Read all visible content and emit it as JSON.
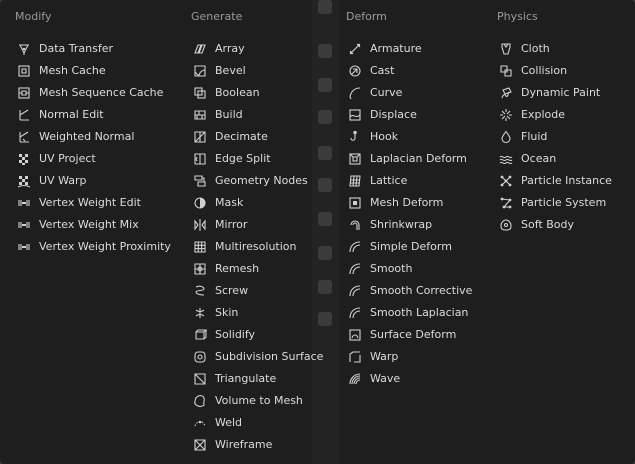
{
  "columns": [
    {
      "header": "Modify",
      "items": [
        {
          "label": "Data Transfer",
          "icon": "data-transfer"
        },
        {
          "label": "Mesh Cache",
          "icon": "mesh-cache"
        },
        {
          "label": "Mesh Sequence Cache",
          "icon": "mesh-sequence-cache"
        },
        {
          "label": "Normal Edit",
          "icon": "normal-edit"
        },
        {
          "label": "Weighted Normal",
          "icon": "weighted-normal"
        },
        {
          "label": "UV Project",
          "icon": "uv-project"
        },
        {
          "label": "UV Warp",
          "icon": "uv-warp"
        },
        {
          "label": "Vertex Weight Edit",
          "icon": "vertex-weight"
        },
        {
          "label": "Vertex Weight Mix",
          "icon": "vertex-weight"
        },
        {
          "label": "Vertex Weight Proximity",
          "icon": "vertex-weight"
        }
      ]
    },
    {
      "header": "Generate",
      "items": [
        {
          "label": "Array",
          "icon": "array"
        },
        {
          "label": "Bevel",
          "icon": "bevel"
        },
        {
          "label": "Boolean",
          "icon": "boolean"
        },
        {
          "label": "Build",
          "icon": "build"
        },
        {
          "label": "Decimate",
          "icon": "decimate"
        },
        {
          "label": "Edge Split",
          "icon": "edge-split"
        },
        {
          "label": "Geometry Nodes",
          "icon": "geometry-nodes"
        },
        {
          "label": "Mask",
          "icon": "mask"
        },
        {
          "label": "Mirror",
          "icon": "mirror"
        },
        {
          "label": "Multiresolution",
          "icon": "multiresolution"
        },
        {
          "label": "Remesh",
          "icon": "remesh"
        },
        {
          "label": "Screw",
          "icon": "screw"
        },
        {
          "label": "Skin",
          "icon": "skin"
        },
        {
          "label": "Solidify",
          "icon": "solidify"
        },
        {
          "label": "Subdivision Surface",
          "icon": "subdivision-surface"
        },
        {
          "label": "Triangulate",
          "icon": "triangulate"
        },
        {
          "label": "Volume to Mesh",
          "icon": "volume-to-mesh"
        },
        {
          "label": "Weld",
          "icon": "weld"
        },
        {
          "label": "Wireframe",
          "icon": "wireframe"
        }
      ]
    },
    {
      "header": "Deform",
      "items": [
        {
          "label": "Armature",
          "icon": "armature"
        },
        {
          "label": "Cast",
          "icon": "cast"
        },
        {
          "label": "Curve",
          "icon": "curve"
        },
        {
          "label": "Displace",
          "icon": "displace"
        },
        {
          "label": "Hook",
          "icon": "hook"
        },
        {
          "label": "Laplacian Deform",
          "icon": "laplacian-deform"
        },
        {
          "label": "Lattice",
          "icon": "lattice"
        },
        {
          "label": "Mesh Deform",
          "icon": "mesh-deform"
        },
        {
          "label": "Shrinkwrap",
          "icon": "shrinkwrap"
        },
        {
          "label": "Simple Deform",
          "icon": "smooth"
        },
        {
          "label": "Smooth",
          "icon": "smooth"
        },
        {
          "label": "Smooth Corrective",
          "icon": "smooth"
        },
        {
          "label": "Smooth Laplacian",
          "icon": "smooth"
        },
        {
          "label": "Surface Deform",
          "icon": "surface-deform"
        },
        {
          "label": "Warp",
          "icon": "warp"
        },
        {
          "label": "Wave",
          "icon": "wave"
        }
      ]
    },
    {
      "header": "Physics",
      "items": [
        {
          "label": "Cloth",
          "icon": "cloth"
        },
        {
          "label": "Collision",
          "icon": "collision"
        },
        {
          "label": "Dynamic Paint",
          "icon": "dynamic-paint"
        },
        {
          "label": "Explode",
          "icon": "explode"
        },
        {
          "label": "Fluid",
          "icon": "fluid"
        },
        {
          "label": "Ocean",
          "icon": "ocean"
        },
        {
          "label": "Particle Instance",
          "icon": "particle-instance"
        },
        {
          "label": "Particle System",
          "icon": "particle-system"
        },
        {
          "label": "Soft Body",
          "icon": "soft-body"
        }
      ]
    }
  ],
  "colors": {
    "menu_bg": "#1e1e1e",
    "text": "#dcdcdc",
    "header_text": "#9a9a9a",
    "icon": "#d0d0d0"
  }
}
